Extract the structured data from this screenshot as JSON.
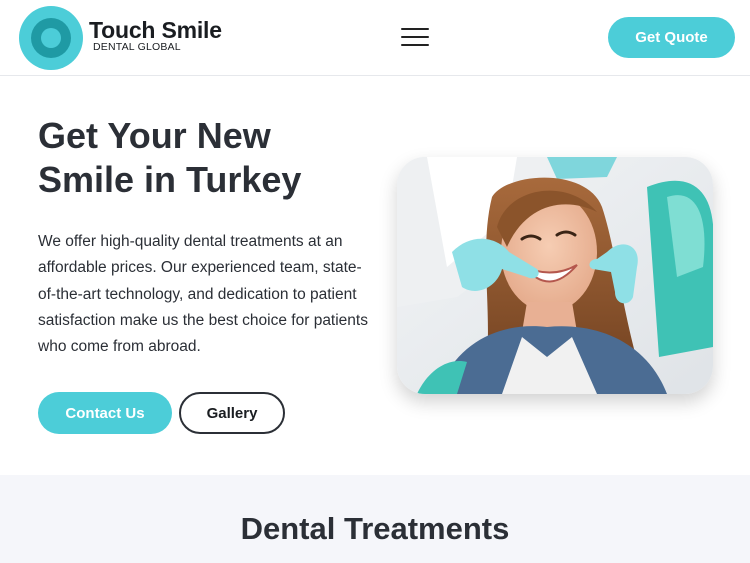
{
  "header": {
    "brand_name": "Touch Smile",
    "brand_sub": "DENTAL GLOBAL",
    "menu_icon": "hamburger-menu-icon",
    "quote_label": "Get Quote"
  },
  "hero": {
    "title": "Get Your New Smile in Turkey",
    "text": "We offer high-quality dental treatments at an affordable prices. Our experienced team, state-of-the-art technology, and dedication to patient satisfaction make us the best choice for patients who come from abroad.",
    "contact_label": "Contact Us",
    "gallery_label": "Gallery"
  },
  "treatments": {
    "title": "Dental Treatments"
  },
  "colors": {
    "accent": "#4ccdd8",
    "accent_dark": "#1f9aa4",
    "text": "#2b2f36",
    "section_bg": "#f5f6fa"
  }
}
